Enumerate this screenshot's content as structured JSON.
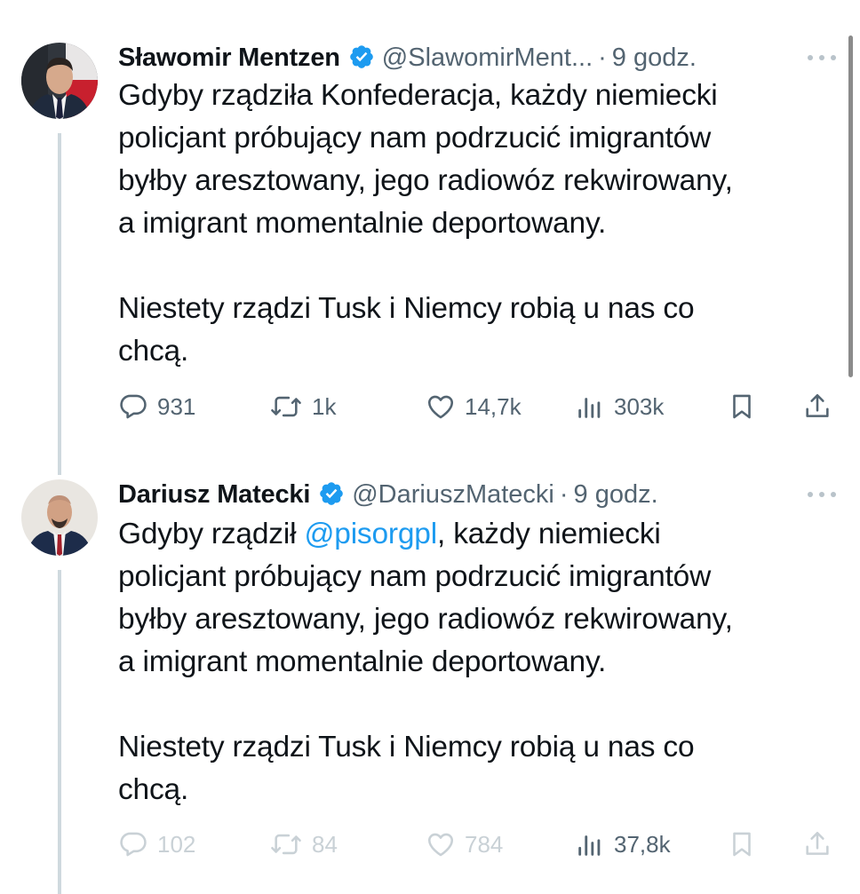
{
  "tweets": [
    {
      "author": "Sławomir Mentzen",
      "handle": "@SlawomirMent...",
      "separator": "·",
      "time": "9 godz.",
      "paragraph1_lines": [
        "Gdyby rządziła Konfederacja, każdy niemiecki",
        "policjant próbujący nam podrzucić imigrantów",
        "byłby aresztowany, jego radiowóz rekwirowany,",
        "a imigrant momentalnie deportowany."
      ],
      "paragraph2_lines": [
        "Niestety rządzi Tusk i Niemcy robią u nas co",
        "chcą."
      ],
      "stats": {
        "replies": "931",
        "reposts": "1k",
        "likes": "14,7k",
        "views": "303k"
      }
    },
    {
      "author": "Dariusz Matecki",
      "handle": "@DariuszMatecki",
      "separator": "·",
      "time": "9 godz.",
      "line1_prefix": "Gdyby rządził ",
      "line1_mention": "@pisorgpl",
      "line1_suffix": ", każdy niemiecki",
      "paragraph1_rest": [
        "policjant próbujący nam podrzucić imigrantów",
        "byłby aresztowany, jego radiowóz rekwirowany,",
        "a imigrant momentalnie deportowany."
      ],
      "paragraph2_lines": [
        "Niestety rządzi Tusk i Niemcy robią u nas co",
        "chcą."
      ],
      "stats": {
        "replies": "102",
        "reposts": "84",
        "likes": "784",
        "views": "37,8k"
      }
    }
  ],
  "icons": {
    "verified": "verified-badge-icon",
    "more": "more-dots-icon",
    "reply": "reply-icon",
    "repost": "repost-icon",
    "like": "heart-icon",
    "views": "views-icon",
    "bookmark": "bookmark-icon",
    "share": "share-icon"
  },
  "colors": {
    "text": "#0f1419",
    "secondary": "#536471",
    "verified": "#1d9bf0",
    "mention": "#1d9bf0",
    "thread_line": "#cfd9de",
    "faded": "#c9d1d6"
  }
}
